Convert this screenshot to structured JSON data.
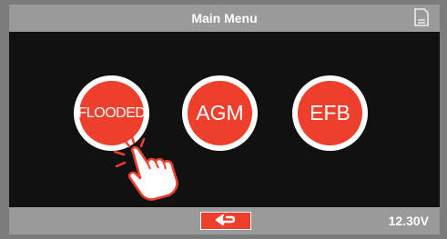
{
  "header": {
    "title": "Main Menu",
    "sd_icon": "sd-card-icon"
  },
  "menu": {
    "buttons": [
      {
        "label": "FLOODED",
        "icon": "none"
      },
      {
        "label": "AGM",
        "icon": "none"
      },
      {
        "label": "EFB",
        "icon": "none"
      }
    ],
    "pointer_icon": "tap-hand-icon"
  },
  "footer": {
    "back_icon": "return-arrow-icon",
    "voltage": "12.30V"
  },
  "colors": {
    "accent": "#ed3f2b",
    "bar": "#9a9a9a",
    "frame": "#7c7c7c",
    "panel": "#111111"
  }
}
